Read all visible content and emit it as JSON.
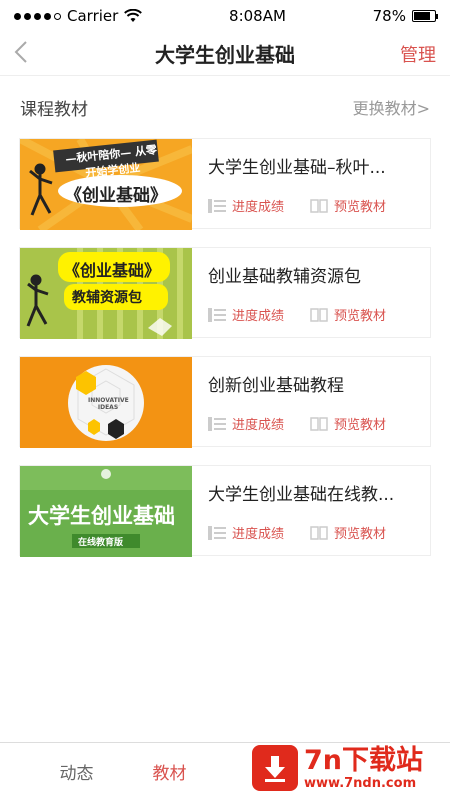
{
  "status": {
    "carrier": "Carrier",
    "time": "8:08AM",
    "battery": "78%",
    "battery_level": 0.78
  },
  "nav": {
    "back_icon": "chevron-left-icon",
    "title": "大学生创业基础",
    "action": "管理"
  },
  "section": {
    "title": "课程教材",
    "link": "更换教材>"
  },
  "books": [
    {
      "title": "大学生创业基础–秋叶...",
      "cover_caption_top": "—秋叶陪你— 从零开始学创业",
      "cover_caption_main": "《创业基础》",
      "progress_label": "进度成绩",
      "preview_label": "预览教材"
    },
    {
      "title": "创业基础教辅资源包",
      "cover_caption_main": "《创业基础》",
      "cover_caption_sub": "教辅资源包",
      "progress_label": "进度成绩",
      "preview_label": "预览教材"
    },
    {
      "title": "创新创业基础教程",
      "cover_caption_main": "INNOVATIVE IDEAS",
      "progress_label": "进度成绩",
      "preview_label": "预览教材"
    },
    {
      "title": "大学生创业基础在线教...",
      "cover_caption_main": "大学生创业基础",
      "cover_caption_sub": "在线教育版",
      "progress_label": "进度成绩",
      "preview_label": "预览教材"
    }
  ],
  "tabs": [
    {
      "label": "动态"
    },
    {
      "label": "教材"
    }
  ],
  "watermark": {
    "title": "7n下载站",
    "url": "www.7ndn.com"
  },
  "colors": {
    "accent": "#d9534f",
    "watermark": "#e02a1c"
  }
}
